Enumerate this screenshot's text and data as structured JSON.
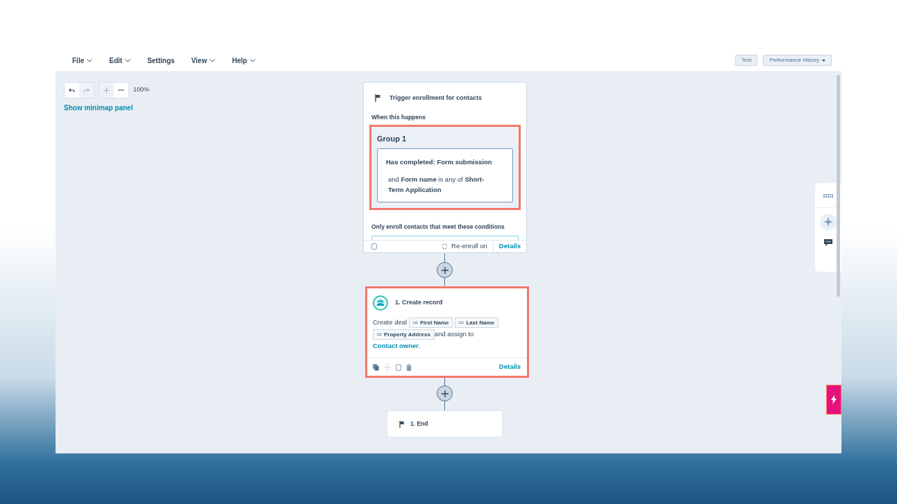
{
  "menu": [
    {
      "label": "File",
      "dropdown": true
    },
    {
      "label": "Edit",
      "dropdown": true
    },
    {
      "label": "Settings",
      "dropdown": false
    },
    {
      "label": "View",
      "dropdown": true
    },
    {
      "label": "Help",
      "dropdown": true
    }
  ],
  "header_buttons": [
    {
      "label": "Test",
      "dropdown": false
    },
    {
      "label": "Performance history",
      "dropdown": true
    }
  ],
  "canvas_controls": {
    "zoom": "100%",
    "minimap_link": "Show minimap panel"
  },
  "trigger": {
    "title": "Trigger enrollment for contacts",
    "section": "When this happens",
    "group": {
      "title": "Group 1",
      "highlighted": true,
      "condition": "Has completed: Form submission",
      "filter": "and **Form name** is any of **Short-Term Application**"
    },
    "second_section": "Only enroll contacts that meet these conditions",
    "reenroll": "Re-enroll on",
    "details": "Details"
  },
  "action": {
    "title": "1. Create record",
    "highlighted": true,
    "parts": [
      {
        "kind": "text",
        "text": "Create deal"
      },
      {
        "kind": "token",
        "text": "First Name"
      },
      {
        "kind": "token",
        "text": "Last Name"
      },
      {
        "kind": "token",
        "text": "Property Address"
      },
      {
        "kind": "text",
        "text": "and assign to"
      },
      {
        "kind": "link",
        "text": "Contact owner"
      },
      {
        "kind": "text",
        "text": "."
      }
    ],
    "details": "Details"
  },
  "end": {
    "title": "1. End"
  }
}
